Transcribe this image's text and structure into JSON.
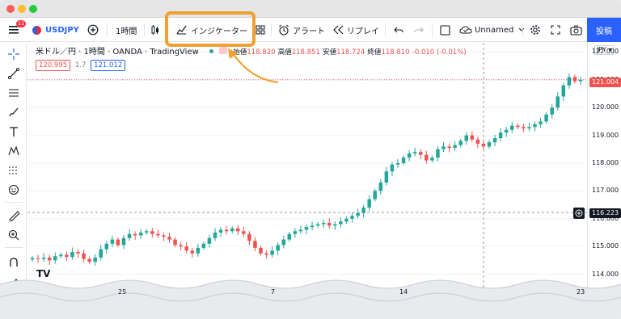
{
  "toolbar": {
    "notification_count": "11",
    "symbol": "USDJPY",
    "interval": "1時間",
    "indicators_label": "インジケーター",
    "alert_label": "アラート",
    "replay_label": "リプレイ",
    "layout_name": "Unnamed",
    "publish_label": "投稿"
  },
  "legend": {
    "title": "米ドル／円 · 1時間 · OANDA · TradingView",
    "open_label": "始値",
    "open": "118.820",
    "high_label": "高値",
    "high": "118.851",
    "low_label": "安値",
    "low": "118.724",
    "close_label": "終値",
    "close": "118.810",
    "change": "-0.010 (-0.01%)",
    "bid": "120.995",
    "spread": "1.7",
    "ask": "121.012"
  },
  "price_axis": {
    "currency": "JPY",
    "ticks": [
      "122.000",
      "121.000",
      "120.000",
      "119.000",
      "118.000",
      "117.000",
      "116.000",
      "115.000",
      "114.000"
    ],
    "last_price": "121.004",
    "crosshair_price": "116.223"
  },
  "time_axis": {
    "ticks": [
      "25",
      "7",
      "14",
      "23"
    ]
  },
  "colors": {
    "up": "#26a69a",
    "down": "#ef5350",
    "highlight": "#f0a030",
    "publish": "#2962ff"
  },
  "chart_data": {
    "type": "candlestick",
    "series": [
      {
        "name": "USDJPY",
        "close": [
          114.58,
          114.55,
          114.6,
          114.5,
          114.65,
          114.7,
          114.62,
          114.8,
          114.75,
          114.55,
          114.45,
          114.6,
          114.9,
          115.1,
          115.25,
          115.05,
          115.3,
          115.45,
          115.4,
          115.5,
          115.55,
          115.45,
          115.4,
          115.35,
          115.25,
          115.05,
          115.0,
          114.85,
          114.75,
          114.95,
          115.1,
          115.3,
          115.5,
          115.6,
          115.55,
          115.65,
          115.55,
          115.45,
          115.2,
          114.95,
          114.75,
          114.7,
          114.85,
          115.05,
          115.25,
          115.45,
          115.55,
          115.6,
          115.7,
          115.75,
          115.8,
          115.85,
          115.75,
          115.8,
          115.9,
          116.0,
          116.1,
          116.2,
          116.4,
          116.7,
          117.0,
          117.3,
          117.7,
          117.95,
          118.0,
          118.2,
          118.35,
          118.4,
          118.3,
          118.1,
          118.2,
          118.5,
          118.6,
          118.55,
          118.65,
          118.8,
          119.0,
          118.85,
          118.7,
          118.6,
          118.75,
          118.9,
          119.1,
          119.2,
          119.35,
          119.3,
          119.25,
          119.3,
          119.4,
          119.5,
          119.75,
          120.0,
          120.4,
          120.8,
          121.1,
          120.95,
          121.0
        ]
      }
    ],
    "xlabels": [
      "25",
      "7",
      "14",
      "23"
    ],
    "ylim": [
      113.9,
      122.1
    ],
    "yticks": [
      114,
      115,
      116,
      117,
      118,
      119,
      120,
      121,
      122
    ],
    "last_price": 121.004
  }
}
